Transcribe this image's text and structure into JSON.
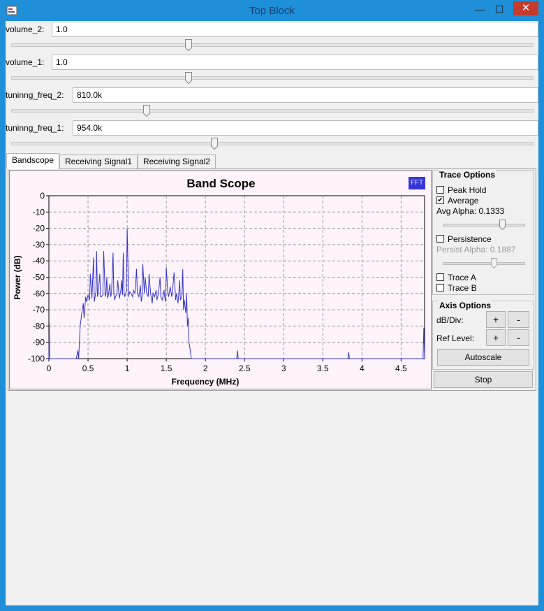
{
  "window": {
    "title": "Top Block",
    "minimize": "—",
    "maximize": "☐",
    "close": "✕"
  },
  "controls": [
    {
      "label": "volume_2:",
      "value": "1.0",
      "slider_fraction": 0.34
    },
    {
      "label": "volume_1:",
      "value": "1.0",
      "slider_fraction": 0.34
    },
    {
      "label": "tuninng_freq_2:",
      "value": "810.0k",
      "slider_fraction": 0.26
    },
    {
      "label": "tuninng_freq_1:",
      "value": "954.0k",
      "slider_fraction": 0.39
    }
  ],
  "tabs": [
    "Bandscope",
    "Receiving Signal1",
    "Receiving Signal2"
  ],
  "active_tab": "Bandscope",
  "scope": {
    "badge": "FFT",
    "trace_color": "#3535c8",
    "background": "#fdf3fb",
    "trace_options": {
      "title": "Trace Options",
      "peak_hold": {
        "label": "Peak Hold",
        "checked": false
      },
      "average": {
        "label": "Average",
        "checked": true
      },
      "avg_alpha": "Avg Alpha: 0.1333",
      "avg_alpha_fraction": 0.73,
      "persistence": {
        "label": "Persistence",
        "checked": false
      },
      "persist_alpha": "Persist Alpha: 0.1887",
      "persist_alpha_fraction": 0.63,
      "trace_a": {
        "label": "Trace A",
        "checked": false
      },
      "trace_b": {
        "label": "Trace B",
        "checked": false
      }
    },
    "axis_options": {
      "title": "Axis Options",
      "db_div_label": "dB/Div:",
      "ref_level_label": "Ref Level:",
      "plus": "+",
      "minus": "-",
      "autoscale": "Autoscale"
    },
    "stop": "Stop"
  },
  "chart_data": {
    "type": "line",
    "title": "Band Scope",
    "xlabel": "Frequency (MHz)",
    "ylabel": "Power (dB)",
    "xlim": [
      0,
      4.8
    ],
    "ylim": [
      -100,
      0
    ],
    "x_ticks": [
      "0",
      "0.5",
      "1",
      "1.5",
      "2",
      "2.5",
      "3",
      "3.5",
      "4",
      "4.5"
    ],
    "x_tick_values": [
      0,
      0.5,
      1,
      1.5,
      2,
      2.5,
      3,
      3.5,
      4,
      4.5
    ],
    "y_ticks": [
      "0",
      "-10",
      "-20",
      "-30",
      "-40",
      "-50",
      "-60",
      "-70",
      "-80",
      "-90",
      "-100"
    ],
    "y_tick_values": [
      0,
      -10,
      -20,
      -30,
      -40,
      -50,
      -60,
      -70,
      -80,
      -90,
      -100
    ],
    "grid": true,
    "series": [
      {
        "x": [
          0,
          0.005,
          0.01,
          0.015,
          0.03,
          0.35,
          0.37,
          0.38,
          0.4,
          0.42,
          0.44,
          0.45,
          0.47,
          0.48,
          0.5,
          0.52,
          0.53,
          0.55,
          0.57,
          0.58,
          0.6,
          0.61,
          0.62,
          0.63,
          0.65,
          0.66,
          0.67,
          0.69,
          0.7,
          0.72,
          0.73,
          0.74,
          0.75,
          0.76,
          0.78,
          0.79,
          0.8,
          0.82,
          0.83,
          0.84,
          0.85,
          0.87,
          0.88,
          0.9,
          0.92,
          0.93,
          0.94,
          0.95,
          0.96,
          0.97,
          0.99,
          1.0,
          1.02,
          1.03,
          1.05,
          1.07,
          1.08,
          1.1,
          1.12,
          1.13,
          1.15,
          1.17,
          1.18,
          1.19,
          1.2,
          1.22,
          1.23,
          1.25,
          1.27,
          1.28,
          1.3,
          1.32,
          1.33,
          1.35,
          1.37,
          1.38,
          1.4,
          1.42,
          1.43,
          1.45,
          1.47,
          1.48,
          1.49,
          1.5,
          1.52,
          1.53,
          1.55,
          1.57,
          1.58,
          1.6,
          1.62,
          1.63,
          1.65,
          1.66,
          1.67,
          1.68,
          1.7,
          1.71,
          1.72,
          1.73,
          1.74,
          1.75,
          1.76,
          1.77,
          1.78,
          1.79,
          1.8,
          1.82,
          1.85,
          2.1,
          2.4,
          2.41,
          2.42,
          2.43,
          2.5,
          3.82,
          3.83,
          3.84,
          3.85,
          4.78,
          4.79,
          4.8
        ],
        "y": [
          -100,
          -78,
          -100,
          -100,
          -100,
          -100,
          -95,
          -100,
          -80,
          -72,
          -66,
          -75,
          -62,
          -65,
          -61,
          -64,
          -48,
          -63,
          -38,
          -65,
          -59,
          -34,
          -62,
          -60,
          -48,
          -62,
          -62,
          -61,
          -34,
          -62,
          -60,
          -50,
          -63,
          -61,
          -54,
          -62,
          -60,
          -35,
          -60,
          -64,
          -62,
          -60,
          -52,
          -63,
          -58,
          -52,
          -61,
          -35,
          -60,
          -62,
          -58,
          -20,
          -62,
          -59,
          -60,
          -62,
          -58,
          -60,
          -45,
          -60,
          -62,
          -55,
          -65,
          -62,
          -42,
          -60,
          -50,
          -60,
          -62,
          -48,
          -60,
          -66,
          -60,
          -62,
          -58,
          -64,
          -60,
          -50,
          -62,
          -64,
          -58,
          -62,
          -65,
          -44,
          -60,
          -62,
          -56,
          -62,
          -58,
          -47,
          -64,
          -60,
          -66,
          -60,
          -52,
          -64,
          -62,
          -45,
          -70,
          -64,
          -68,
          -72,
          -60,
          -80,
          -75,
          -90,
          -93,
          -100,
          -100,
          -100,
          -100,
          -95,
          -100,
          -100,
          -100,
          -100,
          -96,
          -100,
          -100,
          -100,
          -81,
          -100
        ]
      }
    ]
  }
}
